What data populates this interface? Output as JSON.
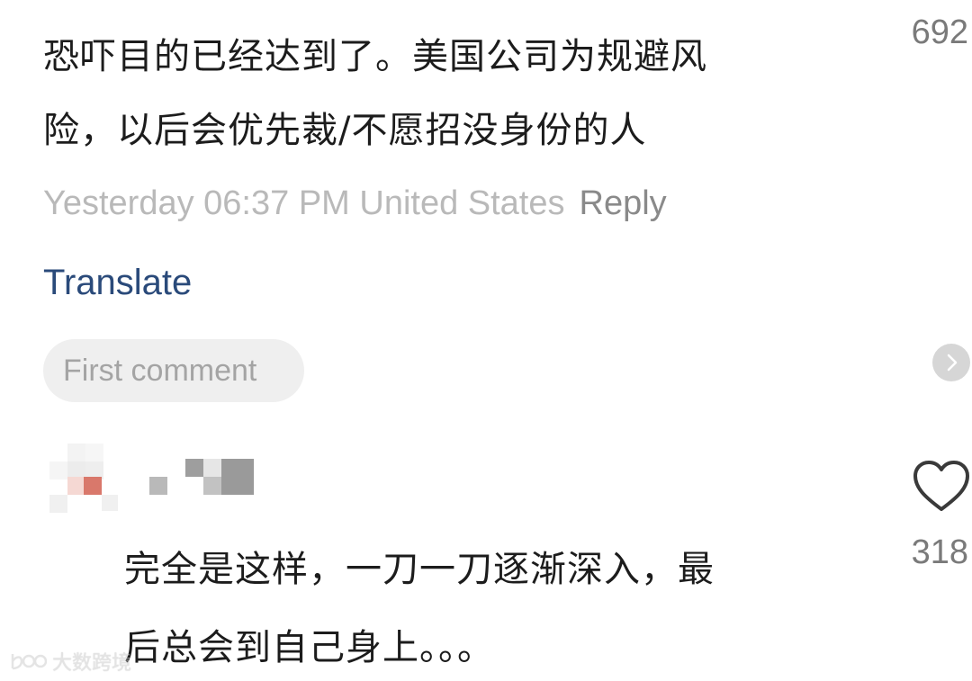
{
  "comment_1": {
    "line1": "恐吓目的已经达到了。美国公司为规避风",
    "line2": "险，以后会优先裁/不愿招没身份的人",
    "timestamp_location": "Yesterday 06:37 PM United States",
    "reply_label": "Reply",
    "translate_label": "Translate",
    "like_count": "692"
  },
  "first_comment_label": "First comment",
  "comment_2": {
    "line1": "完全是这样，一刀一刀逐渐深入，最",
    "line2": "后总会到自己身上。。。",
    "like_count": "318"
  },
  "icons": {
    "next": "chevron-right-icon",
    "like": "heart-outline-icon"
  },
  "watermark": {
    "text": "大数跨境"
  },
  "colors": {
    "link": "#2a4a7a",
    "meta": "#b9b9b9",
    "pill_bg": "#efefef"
  }
}
